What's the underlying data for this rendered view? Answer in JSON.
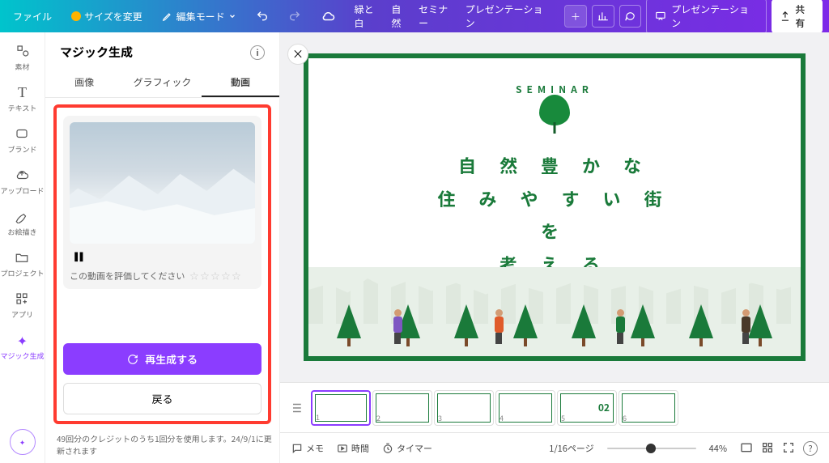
{
  "topbar": {
    "file": "ファイル",
    "resize": "サイズを変更",
    "edit_mode": "編集モード",
    "title_parts": [
      "緑と白",
      "自然",
      "セミナー",
      "プレゼンテーション"
    ],
    "present": "プレゼンテーション",
    "share": "共有"
  },
  "rail": {
    "elements": "素材",
    "text": "テキスト",
    "brand": "ブランド",
    "upload": "アップロード",
    "draw": "お絵描き",
    "project": "プロジェクト",
    "apps": "アプリ",
    "magic": "マジック生成"
  },
  "panel": {
    "title": "マジック生成",
    "tabs": {
      "image": "画像",
      "graphic": "グラフィック",
      "video": "動画"
    },
    "active_tab": "video",
    "rating_prompt": "この動画を評価してください",
    "regenerate": "再生成する",
    "back": "戻る",
    "credit": "49回分のクレジットのうち1回分を使用します。24/9/1に更新されます"
  },
  "slide": {
    "kicker": "SEMINAR",
    "line1": "自 然 豊 か な",
    "line2": "住 み や す い 街 を",
    "line3": "考 え る"
  },
  "thumbs": {
    "count": 6,
    "nums": [
      "1",
      "2",
      "3",
      "4",
      "5",
      "6"
    ],
    "label5_big": "02"
  },
  "bottom": {
    "notes": "メモ",
    "time": "時間",
    "timer": "タイマー",
    "page": "1/16ページ",
    "zoom": "44%"
  }
}
